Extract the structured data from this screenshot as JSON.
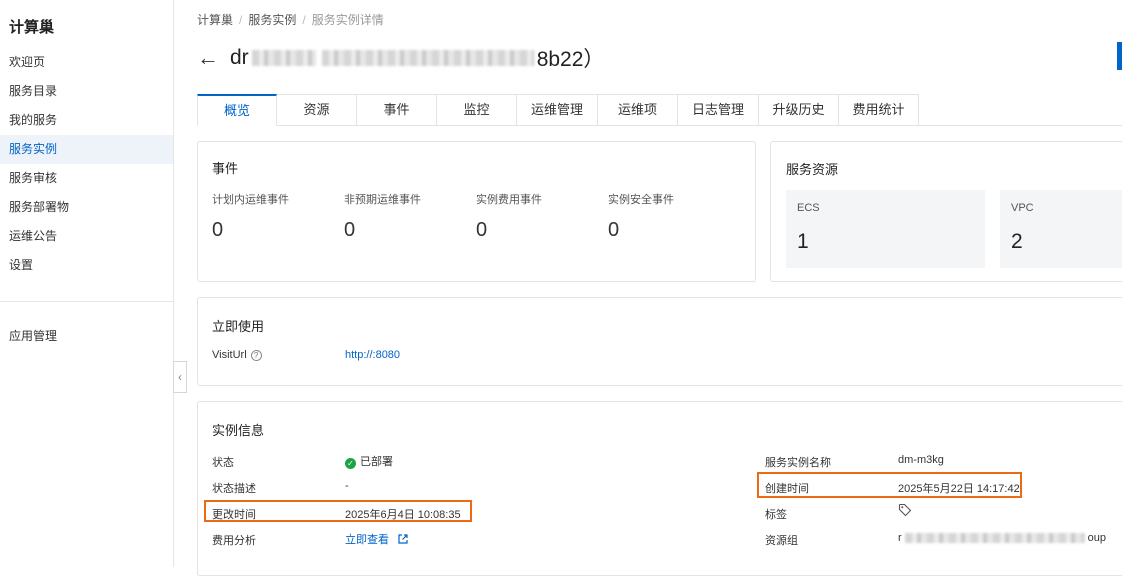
{
  "sidebar": {
    "brand": "计算巢",
    "items": [
      {
        "label": "欢迎页"
      },
      {
        "label": "服务目录"
      },
      {
        "label": "我的服务"
      },
      {
        "label": "服务实例"
      },
      {
        "label": "服务审核"
      },
      {
        "label": "服务部署物"
      },
      {
        "label": "运维公告"
      },
      {
        "label": "设置"
      }
    ],
    "active_index": 3,
    "secondary_items": [
      {
        "label": "应用管理"
      }
    ],
    "collapse_icon": "chevron-left-icon"
  },
  "breadcrumb": {
    "items": [
      "计算巢",
      "服务实例",
      "服务实例详情"
    ],
    "separator": "/"
  },
  "header": {
    "back_icon": "arrow-left-icon",
    "title_prefix": "dr",
    "title_suffix": "8b22）"
  },
  "tabs": [
    {
      "label": "概览"
    },
    {
      "label": "资源"
    },
    {
      "label": "事件"
    },
    {
      "label": "监控"
    },
    {
      "label": "运维管理"
    },
    {
      "label": "运维项"
    },
    {
      "label": "日志管理"
    },
    {
      "label": "升级历史"
    },
    {
      "label": "费用统计"
    }
  ],
  "events": {
    "title": "事件",
    "items": [
      {
        "label": "计划内运维事件",
        "value": "0"
      },
      {
        "label": "非预期运维事件",
        "value": "0"
      },
      {
        "label": "实例费用事件",
        "value": "0"
      },
      {
        "label": "实例安全事件",
        "value": "0"
      }
    ]
  },
  "resources": {
    "title": "服务资源",
    "items": [
      {
        "label": "ECS",
        "value": "1"
      },
      {
        "label": "VPC",
        "value": "2"
      }
    ]
  },
  "usage": {
    "title": "立即使用",
    "visit_label": "VisitUrl",
    "help_icon": "question-circle-icon",
    "visit_url": "http://:8080"
  },
  "instance_info": {
    "title": "实例信息",
    "status_label": "状态",
    "status_value": "已部署",
    "status_icon": "check-circle-icon",
    "desc_label": "状态描述",
    "desc_value": "-",
    "modified_label": "更改时间",
    "modified_value": "2025年6月4日 10:08:35",
    "cost_label": "费用分析",
    "cost_link": "立即查看",
    "external_icon": "external-link-icon",
    "name_label": "服务实例名称",
    "name_value": "dm-m3kg",
    "created_label": "创建时间",
    "created_value": "2025年5月22日 14:17:42",
    "tags_label": "标签",
    "tag_icon": "tag-icon",
    "rg_label": "资源组",
    "rg_prefix": "r",
    "rg_suffix": "oup"
  },
  "colors": {
    "accent": "#0064c8",
    "highlight": "#ec6a15",
    "success": "#1ba345"
  }
}
